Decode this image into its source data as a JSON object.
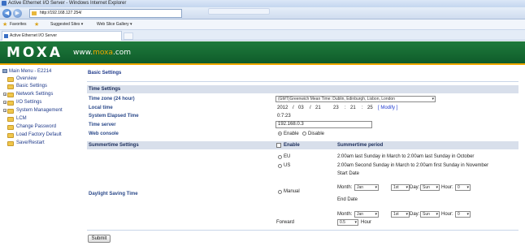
{
  "window": {
    "title": "Active Ethernet I/O Server - Windows Internet Explorer"
  },
  "browser": {
    "back": "◀",
    "forward": "▶",
    "address": "http://192.168.127.254/",
    "favorites": "Favorites",
    "suggested": "Suggested Sites ▾",
    "web_slice": "Web Slice Gallery ▾",
    "tab_title": "Active Ethernet I/O Server"
  },
  "banner": {
    "logo": "MOXA",
    "site_prefix": "www.",
    "site_domain": "moxa",
    "site_suffix": ".com"
  },
  "sidebar": {
    "title": "Main Menu - E2214",
    "items": [
      {
        "label": "Overview"
      },
      {
        "label": "Basic Settings"
      },
      {
        "label": "Network Settings",
        "expand": "+"
      },
      {
        "label": "I/O Settings",
        "expand": "+"
      },
      {
        "label": "System Management",
        "expand": "+"
      },
      {
        "label": "LCM"
      },
      {
        "label": "Change Password"
      },
      {
        "label": "Load Factory Default"
      },
      {
        "label": "Save/Restart"
      }
    ]
  },
  "page": {
    "title": "Basic Settings",
    "time_settings": {
      "header": "Time Settings",
      "tz_label": "Time zone (24 hour)",
      "tz_value": "(GMT)Greenwich Mean Time: Dublin, Edinburgh, Lisbon, London",
      "local_label": "Local time",
      "year": "2012",
      "month": "03",
      "day": "21",
      "hour": "23",
      "minute": "21",
      "second": "25",
      "sep_slash": "/",
      "sep_colon": ":",
      "modify": "[ Modify ]",
      "elapsed_label": "System Elapsed Time",
      "elapsed_value": "0:7:23",
      "server_label": "Time server",
      "server_value": "192.168.0.3",
      "console_label": "Web console",
      "enable": "Enable",
      "disable": "Disable"
    },
    "summer": {
      "header": "Summertime Settings",
      "enable_label": "Enable",
      "period_header": "Summertime period",
      "dst_label": "Daylight Saving Time",
      "eu": "EU",
      "eu_text": "2:00am last Sunday in March to 2:00am last Sunday in October",
      "us": "US",
      "us_text": "2:00am Second Sunday in March to 2:00am first Sunday in November",
      "manual": "Manual",
      "start_date": "Start Date",
      "end_date": "End Date",
      "month_label": "Month:",
      "day_label": "Day:",
      "hour_label": "Hour:",
      "month_value": "Jan",
      "week_value": "1st",
      "day_value": "Sun",
      "hour_value": "0",
      "forward_label": "Forward",
      "forward_value": "0.5",
      "forward_unit": "Hour"
    },
    "submit": "Submit"
  }
}
